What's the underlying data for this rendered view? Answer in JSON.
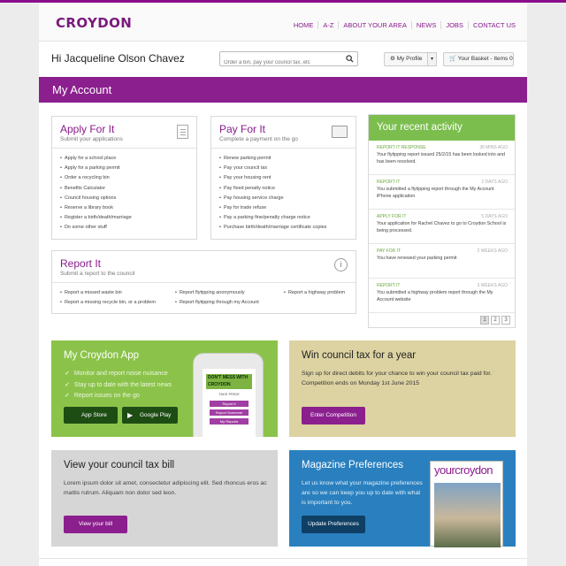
{
  "brand": {
    "logo": "CROYDON",
    "accent": "#8b1f8e",
    "green": "#7cbe4e"
  },
  "nav": [
    "HOME",
    "A-Z",
    "ABOUT YOUR AREA",
    "NEWS",
    "JOBS",
    "CONTACT US"
  ],
  "greeting": "Hi Jacqueline Olson Chavez",
  "search": {
    "placeholder": "Order a bin, pay your council tax, etc"
  },
  "profile_button": "My Profile",
  "basket_button": "Your Basket - Items 0",
  "account_title": "My Account",
  "apply": {
    "title": "Apply For It",
    "subtitle": "Submit your applications",
    "items": [
      "Apply for a school place",
      "Apply for a parking permit",
      "Order a recycling bin",
      "Benefits Calculator",
      "Council housing options",
      "Reserve a library book",
      "Register a birth/death/marriage",
      "Do some other stuff"
    ]
  },
  "pay": {
    "title": "Pay For It",
    "subtitle": "Complete a payment on the go",
    "items": [
      "Renew parking permit",
      "Pay your council tax",
      "Pay your housing rent",
      "Pay fixed penalty notice",
      "Pay housing service charge",
      "Pay for trade refuse",
      "Pay a parking fine/penalty charge notice",
      "Purchase birth/death/marriage certificate copies"
    ]
  },
  "report": {
    "title": "Report It",
    "subtitle": "Submit a report to the council",
    "col1": [
      "Report a missed waste bin",
      "Report a missing recycle bin, or a problem"
    ],
    "col2": [
      "Report flytipping anonymously",
      "Report flytipping through my Account"
    ],
    "col3": [
      "Report a highway problem"
    ]
  },
  "activity": {
    "title": "Your recent activity",
    "items": [
      {
        "type": "REPORT IT RESPONSE",
        "date": "30 MINS AGO",
        "text": "Your flytipping report issued 25/2/15 has been looked into and has been resolved."
      },
      {
        "type": "REPORT IT",
        "date": "2 DAYS AGO",
        "text": "You submitted a flytipping report through the My Account iPhone application"
      },
      {
        "type": "APPLY FOR IT",
        "date": "5 DAYS AGO",
        "text": "Your application for Rachel Chavez to go to Croydon School is being processed."
      },
      {
        "type": "PAY FOR IT",
        "date": "2 WEEKS AGO",
        "text": "You have renewed your parking permit"
      },
      {
        "type": "REPORT IT",
        "date": "3 WEEKS AGO",
        "text": "You submitted a highway problem report through the My Account website"
      }
    ],
    "pages": [
      "1",
      "2",
      "3"
    ]
  },
  "app_promo": {
    "title": "My Croydon App",
    "features": [
      "Monitor and report noise nuisance",
      "Stay up to date with the latest news",
      "Report issues on the go"
    ],
    "app_store": "App Store",
    "google_play": "Google Play",
    "phone_tag": "DON'T MESS WITH CROYDON",
    "phone_sub": "TAKE PRIDE",
    "phone_buttons": [
      "Report it",
      "Report Someone",
      "My Reports"
    ]
  },
  "tax_promo": {
    "title": "Win council tax for a year",
    "text": "Sign up for direct debits for your chance to win your council tax paid for. Competition ends on Monday 1st June 2015",
    "button": "Enter Competition"
  },
  "bill_promo": {
    "title": "View your council tax bill",
    "text": "Lorem ipsum dolor sit amet, consectetur adipiscing elit. Sed rhoncus eros ac mattis rutrum. Aliquam non dolor sed leon.",
    "button": "View your bill"
  },
  "mag_promo": {
    "title": "Magazine Preferences",
    "text": "Let us know what your magazine preferences are so we can keep you up to date with what is important to you.",
    "button": "Update Preferences",
    "cover_title": "yourcroydon"
  }
}
